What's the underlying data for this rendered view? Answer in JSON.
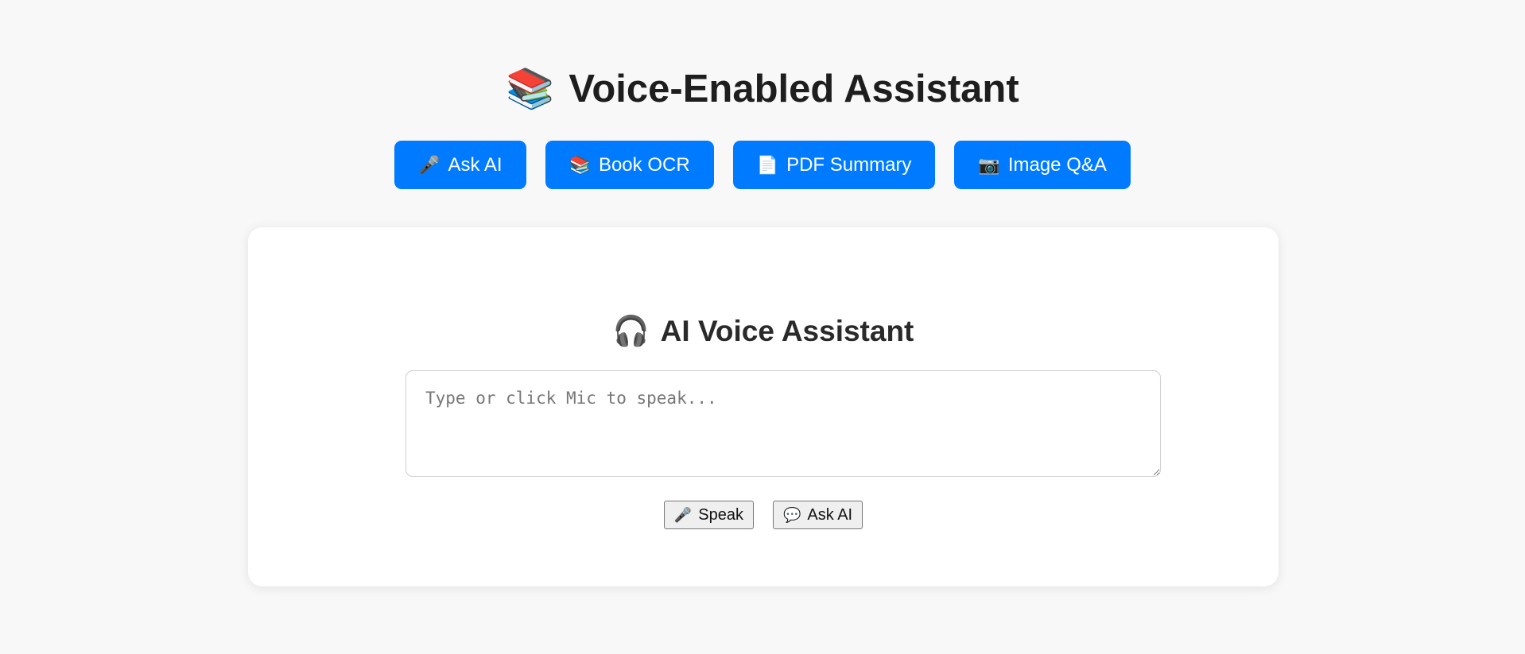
{
  "header": {
    "icon": "books-icon",
    "icon_glyph": "📚",
    "title": "Voice-Enabled Assistant"
  },
  "nav": {
    "accent_color": "#007bff",
    "items": [
      {
        "icon": "microphone-icon",
        "glyph": "🎤",
        "label": "Ask AI"
      },
      {
        "icon": "books-icon",
        "glyph": "📚",
        "label": "Book OCR"
      },
      {
        "icon": "document-icon",
        "glyph": "📄",
        "label": "PDF Summary"
      },
      {
        "icon": "camera-icon",
        "glyph": "📷",
        "label": "Image Q&A"
      }
    ]
  },
  "panel": {
    "icon": "headphones-icon",
    "icon_glyph": "🎧",
    "title": "AI Voice Assistant",
    "input": {
      "value": "",
      "placeholder": "Type or click Mic to speak..."
    },
    "buttons": [
      {
        "icon": "microphone-icon",
        "glyph": "🎤",
        "label": "Speak"
      },
      {
        "icon": "speech-bubble-icon",
        "glyph": "💬",
        "label": "Ask AI"
      }
    ]
  }
}
